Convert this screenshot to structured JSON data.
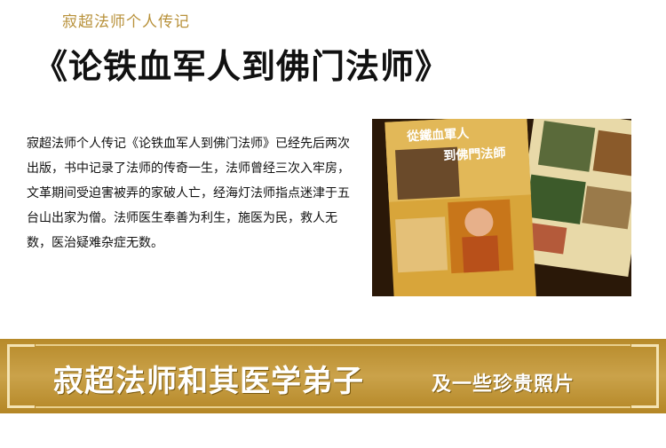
{
  "header": {
    "subtitle": "寂超法师个人传记",
    "title": "《论铁血军人到佛门法师》"
  },
  "description": {
    "text": "寂超法师个人传记《论铁血军人到佛门法师》已经先后两次出版，书中记录了法师的传奇一生，法师曾经三次入牢房，文革期间受迫害被弄的家破人亡，经海灯法师指点迷津于五台山出家为僧。法师医生奉善为利生，施医为民，救人无数，医治疑难杂症无数。"
  },
  "photo": {
    "book_title_line1": "從鐵血軍人",
    "book_title_line2": "到佛門法師"
  },
  "banner": {
    "main": "寂超法师和其医学弟子",
    "sub": "及一些珍贵照片"
  }
}
